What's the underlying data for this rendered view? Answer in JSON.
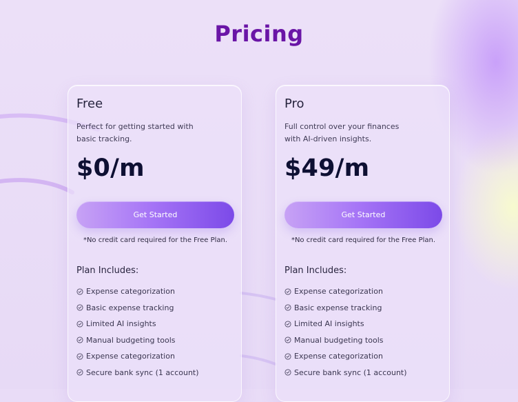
{
  "page": {
    "title": "Pricing"
  },
  "colors": {
    "accent": "#6a15a6",
    "button_start": "#c7a2f5",
    "button_end": "#7c4ae8",
    "background": "#e9dcf7",
    "dark_text": "#0e1033"
  },
  "plans": [
    {
      "name": "Free",
      "description_lines": [
        "Perfect for getting started with",
        "basic tracking."
      ],
      "price": "$0/m",
      "cta": "Get Started",
      "note": "*No credit card required for the Free Plan.",
      "includes_title": "Plan Includes:",
      "features": [
        "Expense categorization",
        "Basic expense tracking",
        "Limited AI insights",
        "Manual budgeting tools",
        "Expense categorization",
        "Secure bank sync (1 account)"
      ]
    },
    {
      "name": "Pro",
      "description_lines": [
        "Full control over your finances",
        "with AI-driven insights."
      ],
      "price": "$49/m",
      "cta": "Get Started",
      "note": "*No credit card required for the Free Plan.",
      "includes_title": "Plan Includes:",
      "features": [
        "Expense categorization",
        "Basic expense tracking",
        "Limited AI insights",
        "Manual budgeting tools",
        "Expense categorization",
        "Secure bank sync (1 account)"
      ]
    }
  ],
  "icons": {
    "feature_bullet": "check-circle-icon"
  }
}
